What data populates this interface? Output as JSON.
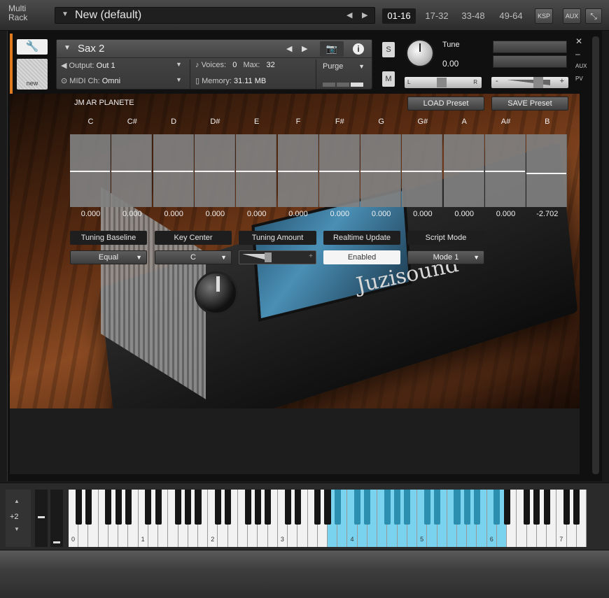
{
  "multirack": {
    "label": "Multi Rack",
    "preset_name": "New (default)",
    "tabs": [
      "01-16",
      "17-32",
      "33-48",
      "49-64"
    ],
    "active_tab": "01-16",
    "ksp_label": "KSP",
    "aux_label": "AUX"
  },
  "instrument": {
    "name": "Sax 2",
    "output_label": "Output:",
    "output_value": "Out 1",
    "voices_label": "Voices:",
    "voices_value": "0",
    "max_label": "Max:",
    "max_value": "32",
    "purge_label": "Purge",
    "midi_label": "MIDI Ch:",
    "midi_value": "Omni",
    "memory_label": "Memory:",
    "memory_value": "31.11 MB",
    "new_label": "new",
    "solo_label": "S",
    "mute_label": "M",
    "tune_label": "Tune",
    "tune_value": "0.00",
    "pan_left": "L",
    "pan_right": "R",
    "vol_minus": "-",
    "vol_plus": "+",
    "side_aux": "AUX",
    "side_pv": "PV"
  },
  "script": {
    "title": "JM AR PLANETE",
    "load_preset": "LOAD Preset",
    "save_preset": "SAVE Preset",
    "notes": [
      "C",
      "C#",
      "D",
      "D#",
      "E",
      "F",
      "F#",
      "G",
      "G#",
      "A",
      "A#",
      "B"
    ],
    "values": [
      "0.000",
      "0.000",
      "0.000",
      "0.000",
      "0.000",
      "0.000",
      "0.000",
      "0.000",
      "0.000",
      "0.000",
      "0.000",
      "-2.702"
    ],
    "value_numbers": [
      0,
      0,
      0,
      0,
      0,
      0,
      0,
      0,
      0,
      0,
      0,
      -2.702
    ],
    "controls": {
      "tuning_baseline_label": "Tuning Baseline",
      "tuning_baseline_value": "Equal",
      "key_center_label": "Key Center",
      "key_center_value": "C",
      "tuning_amount_label": "Tuning Amount",
      "realtime_update_label": "Realtime Update",
      "realtime_update_value": "Enabled",
      "script_mode_label": "Script Mode",
      "script_mode_value": "Mode 1"
    },
    "brand_text": "Juzisound"
  },
  "keyboard": {
    "octave_offset": "+2",
    "octave_labels": [
      "0",
      "1",
      "2",
      "3",
      "4",
      "5",
      "6",
      "7"
    ],
    "highlight_color": "#79d2ee"
  },
  "colors": {
    "accent_orange": "#e07a1e",
    "keyswitch_blue": "#79d2ee"
  }
}
